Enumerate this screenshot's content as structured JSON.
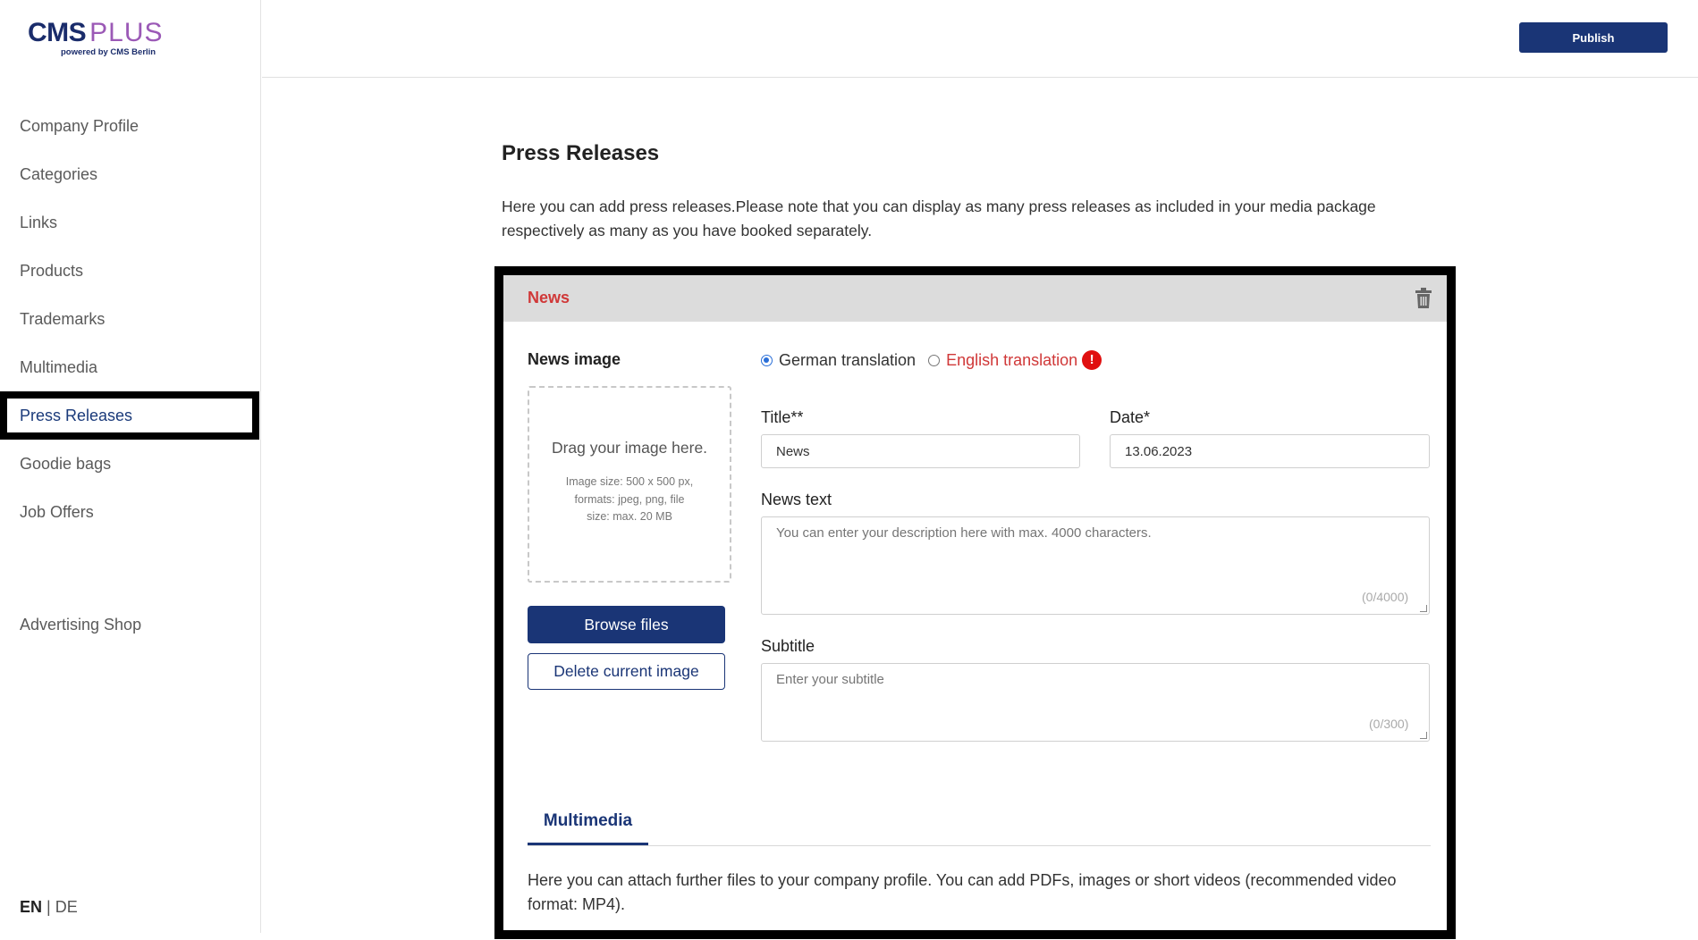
{
  "logo": {
    "main": "CMS",
    "accent": "PLUS",
    "tagline": "powered by CMS Berlin"
  },
  "sidebar": {
    "items": [
      {
        "label": "Company Profile"
      },
      {
        "label": "Categories"
      },
      {
        "label": "Links"
      },
      {
        "label": "Products"
      },
      {
        "label": "Trademarks"
      },
      {
        "label": "Multimedia"
      },
      {
        "label": "Press Releases",
        "active": true
      },
      {
        "label": "Goodie bags"
      },
      {
        "label": "Job Offers"
      }
    ],
    "shop": "Advertising Shop",
    "lang": {
      "en": "EN",
      "sep": "|",
      "de": "DE"
    }
  },
  "topbar": {
    "publish_label": "Publish"
  },
  "page": {
    "title": "Press Releases",
    "description": "Here you can add press releases.Please note that you can display as many press releases as included in your media package respectively as many as you have booked separately."
  },
  "card": {
    "header_title": "News",
    "image_label": "News image",
    "dropzone_title": "Drag your image here.",
    "dropzone_info": "Image size: 500 x 500 px, formats: jpeg, png, file size: max. 20 MB",
    "browse_label": "Browse files",
    "delete_label": "Delete current image",
    "radio_de": "German translation",
    "radio_en": "English translation",
    "warn_icon": "!",
    "title_label": "Title**",
    "title_value": "News",
    "date_label": "Date*",
    "date_value": "13.06.2023",
    "news_text_label": "News text",
    "news_text_placeholder": "You can enter your description here with max. 4000 characters.",
    "news_text_counter": "(0/4000)",
    "subtitle_label": "Subtitle",
    "subtitle_placeholder": "Enter your subtitle",
    "subtitle_counter": "(0/300)",
    "tab_multimedia": "Multimedia",
    "multimedia_desc": "Here you can attach further files to your company profile. You can add PDFs, images or short videos (recommended video format: MP4)."
  },
  "colors": {
    "brand": "#1a3576",
    "accent_purple": "#9b59b6",
    "error_red": "#d03838",
    "header_grey": "#dcdcdc"
  }
}
